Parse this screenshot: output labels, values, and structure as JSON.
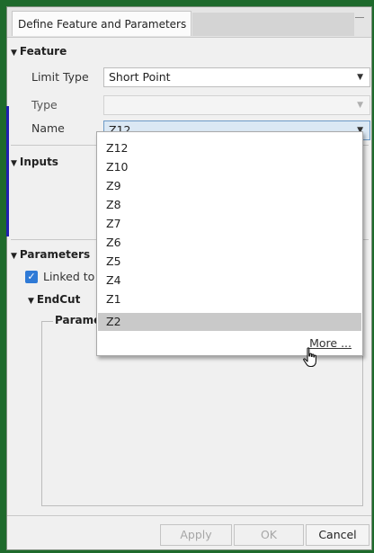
{
  "window": {
    "tab_title": "Define Feature and Parameters"
  },
  "feature": {
    "header": "Feature",
    "limit_type_label": "Limit Type",
    "limit_type_value": "Short Point",
    "type_label": "Type",
    "type_value": "",
    "name_label": "Name",
    "name_value": "Z12"
  },
  "inputs": {
    "header": "Inputs"
  },
  "parameters": {
    "header": "Parameters",
    "linked_label": "Linked to",
    "endcut_header": "EndCut",
    "group_title": "Paramet"
  },
  "name_dropdown": {
    "options": [
      "Z12",
      "Z10",
      "Z9",
      "Z8",
      "Z7",
      "Z6",
      "Z5",
      "Z4",
      "Z1",
      "Z2"
    ],
    "highlighted": "Z2",
    "more_label": "More ..."
  },
  "footer": {
    "apply_label": "Apply",
    "ok_label": "OK",
    "cancel_label": "Cancel"
  },
  "icons": {
    "minimize": "minimize-icon",
    "expand": "triangle-down-icon",
    "dropdown_arrow": "chevron-down-icon",
    "checkbox": "checkmark-icon",
    "cursor": "hand-pointer-icon"
  }
}
